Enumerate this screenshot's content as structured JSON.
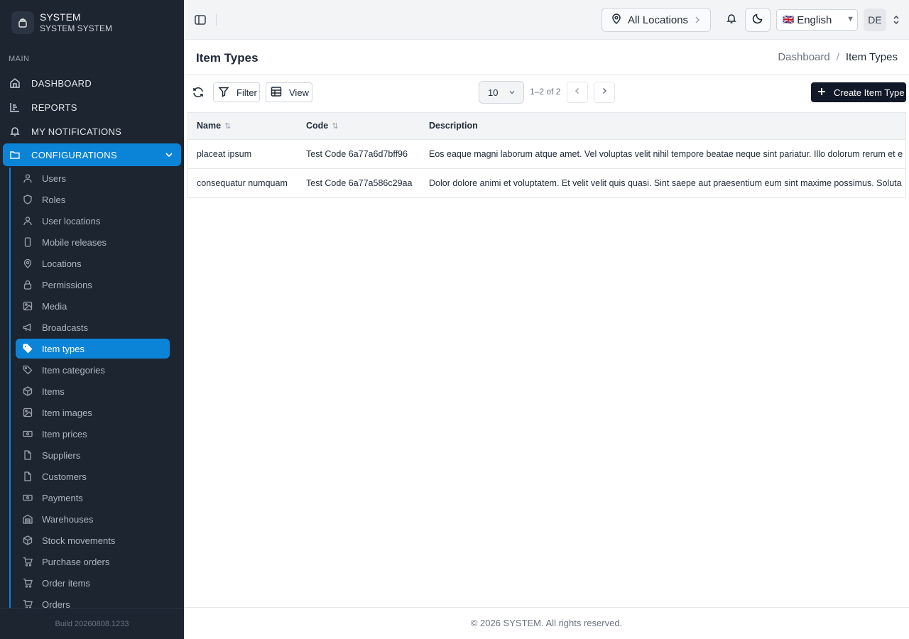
{
  "brand": {
    "name": "SYSTEM",
    "subtitle": "SYSTEM SYSTEM"
  },
  "sidebar": {
    "section_label": "MAIN",
    "top_items": [
      {
        "label": "DASHBOARD",
        "icon": "home-icon"
      },
      {
        "label": "REPORTS",
        "icon": "chart-icon"
      },
      {
        "label": "MY NOTIFICATIONS",
        "icon": "bell-icon"
      },
      {
        "label": "CONFIGURATIONS",
        "icon": "folder-icon"
      }
    ],
    "sub_items": [
      {
        "label": "Users",
        "icon": "user-icon"
      },
      {
        "label": "Roles",
        "icon": "shield-icon"
      },
      {
        "label": "User locations",
        "icon": "user-icon"
      },
      {
        "label": "Mobile releases",
        "icon": "phone-icon"
      },
      {
        "label": "Locations",
        "icon": "map-pin-icon"
      },
      {
        "label": "Permissions",
        "icon": "lock-icon"
      },
      {
        "label": "Media",
        "icon": "image-icon"
      },
      {
        "label": "Broadcasts",
        "icon": "megaphone-icon"
      },
      {
        "label": "Item types",
        "icon": "tag-icon"
      },
      {
        "label": "Item categories",
        "icon": "tag-icon"
      },
      {
        "label": "Items",
        "icon": "box-icon"
      },
      {
        "label": "Item images",
        "icon": "image-icon"
      },
      {
        "label": "Item prices",
        "icon": "banknote-icon"
      },
      {
        "label": "Suppliers",
        "icon": "file-icon"
      },
      {
        "label": "Customers",
        "icon": "file-icon"
      },
      {
        "label": "Payments",
        "icon": "banknote-icon"
      },
      {
        "label": "Warehouses",
        "icon": "warehouse-icon"
      },
      {
        "label": "Stock movements",
        "icon": "box-icon"
      },
      {
        "label": "Purchase orders",
        "icon": "cart-icon"
      },
      {
        "label": "Order items",
        "icon": "cart-icon"
      },
      {
        "label": "Orders",
        "icon": "cart-icon"
      }
    ],
    "build": "Build 20260808.1233"
  },
  "header": {
    "location_label": "All Locations",
    "language": {
      "flag": "🇬🇧",
      "label": "English"
    },
    "avatar_initials": "DE"
  },
  "page": {
    "title": "Item Types",
    "breadcrumb": {
      "parent": "Dashboard",
      "separator": "/",
      "current": "Item Types"
    }
  },
  "toolbar": {
    "filter_label": "Filter",
    "view_label": "View",
    "page_size": "10",
    "range_text": "1–2 of 2",
    "create_label": "Create Item Type"
  },
  "table": {
    "columns": [
      "Name",
      "Code",
      "Description"
    ],
    "rows": [
      {
        "name": "placeat ipsum",
        "code": "Test Code 6a77a6d7bff96",
        "description": "Eos eaque magni laborum atque amet. Vel voluptas velit nihil tempore beatae neque sint pariatur. Illo dolorum rerum et e"
      },
      {
        "name": "consequatur numquam",
        "code": "Test Code 6a77a586c29aa",
        "description": "Dolor dolore animi et voluptatem. Et velit velit quis quasi. Sint saepe aut praesentium eum sint maxime possimus. Soluta"
      }
    ]
  },
  "footer": {
    "text": "© 2026 SYSTEM. All rights reserved."
  }
}
